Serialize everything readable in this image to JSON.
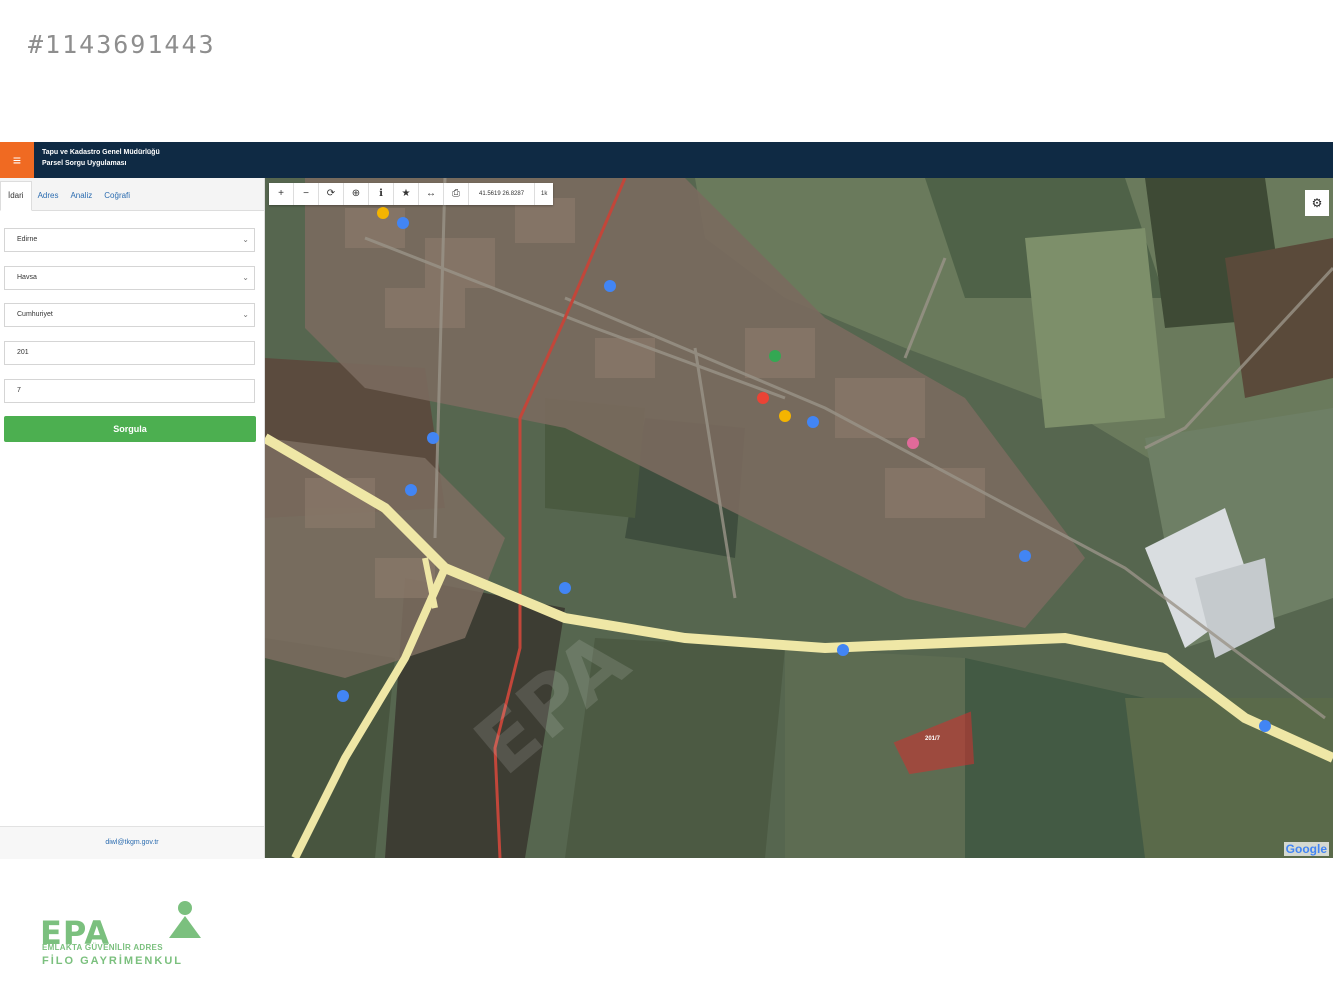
{
  "listing_id": "#1143691443",
  "header": {
    "menu_icon": "hamburger-icon",
    "title_line1": "Tapu ve Kadastro Genel Müdürlüğü",
    "title_line2": "Parsel Sorgu Uygulaması",
    "bg_color": "#0f2a44",
    "menu_color": "#f06a22"
  },
  "sidebar": {
    "tabs": [
      {
        "label": "İdari",
        "active": true
      },
      {
        "label": "Adres",
        "active": false
      },
      {
        "label": "Analiz",
        "active": false
      },
      {
        "label": "Coğrafi",
        "active": false
      }
    ],
    "province": "Edirne",
    "district": "Havsa",
    "neighborhood": "Cumhuriyet",
    "block": "201",
    "parcel": "7",
    "query_button": "Sorgula",
    "query_color": "#4caf50",
    "footer_email": "diwl@tkgm.gov.tr"
  },
  "map": {
    "toolbar": {
      "zoom_in": "+",
      "zoom_out": "−",
      "refresh_icon": "refresh-icon",
      "target_icon": "locate-icon",
      "info_icon": "info-icon",
      "star_icon": "star-icon",
      "measure_icon": "measure-icon",
      "print_icon": "print-icon",
      "coordinates": "41.5619 26.8287",
      "scale": "1k"
    },
    "settings_icon": "gear-icon",
    "parcel_label": "201/7",
    "parcel_color": "#d32f2f",
    "google_logo": "Google",
    "watermark": "EPA"
  },
  "logo": {
    "main": "EPA",
    "line1": "EMLAKTA GÜVENİLİR ADRES",
    "line2": "FİLO GAYRİMENKUL",
    "color": "#7bc07e"
  }
}
